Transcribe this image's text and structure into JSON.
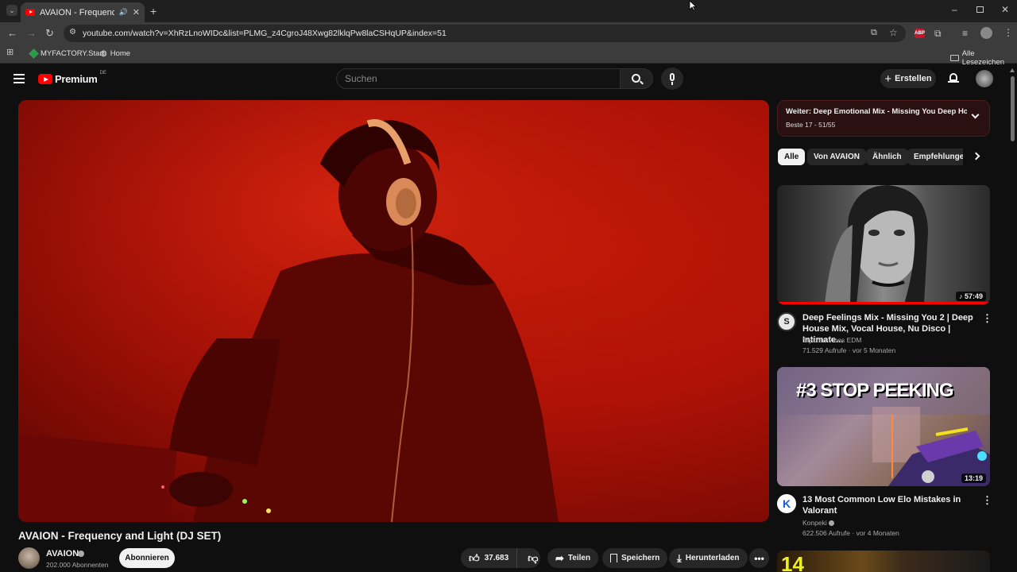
{
  "browser": {
    "tab_title": "AVAION - Frequency and Li",
    "url": "youtube.com/watch?v=XhRzLnoWIDc&list=PLMG_z4CgroJ48Xwg82lklqPw8laCSHqUP&index=51",
    "bookmarks": [
      "MYFACTORY.Start",
      "Home"
    ],
    "all_bookmarks": "Alle Lesezeichen"
  },
  "youtube": {
    "logo": "Premium",
    "region": "DE",
    "search_placeholder": "Suchen",
    "create_label": "Erstellen"
  },
  "video": {
    "title": "AVAION - Frequency and Light (DJ SET)",
    "channel": "AVAION",
    "subscribers": "202.000 Abonnenten",
    "subscribe_label": "Abonnieren",
    "likes": "37.683",
    "share_label": "Teilen",
    "save_label": "Speichern",
    "download_label": "Herunterladen"
  },
  "playlist": {
    "next_label": "Weiter: Deep Emotional Mix - Missing You Deep Ho...",
    "sub_label": "Beste 17 - 51/55"
  },
  "chips": [
    "Alle",
    "Von AVAION",
    "Ähnlich",
    "Empfehlungen"
  ],
  "recommendations": [
    {
      "title": "Deep Feelings Mix - Missing You 2 | Deep House Mix, Vocal House, Nu Disco | Intimate...",
      "channel": "Stylized Vibes EDM",
      "meta": "71.529 Aufrufe · vor 5 Monaten",
      "duration": "57:49"
    },
    {
      "title": "13 Most Common Low Elo Mistakes in Valorant",
      "channel": "Konpeki",
      "meta": "622.506 Aufrufe · vor 4 Monaten",
      "duration": "13:19",
      "thumb_text": "#3 STOP PEEKING"
    },
    {
      "thumb_text": "14"
    }
  ],
  "colors": {
    "accent": "#ff0000",
    "background": "#0f0f0f"
  }
}
